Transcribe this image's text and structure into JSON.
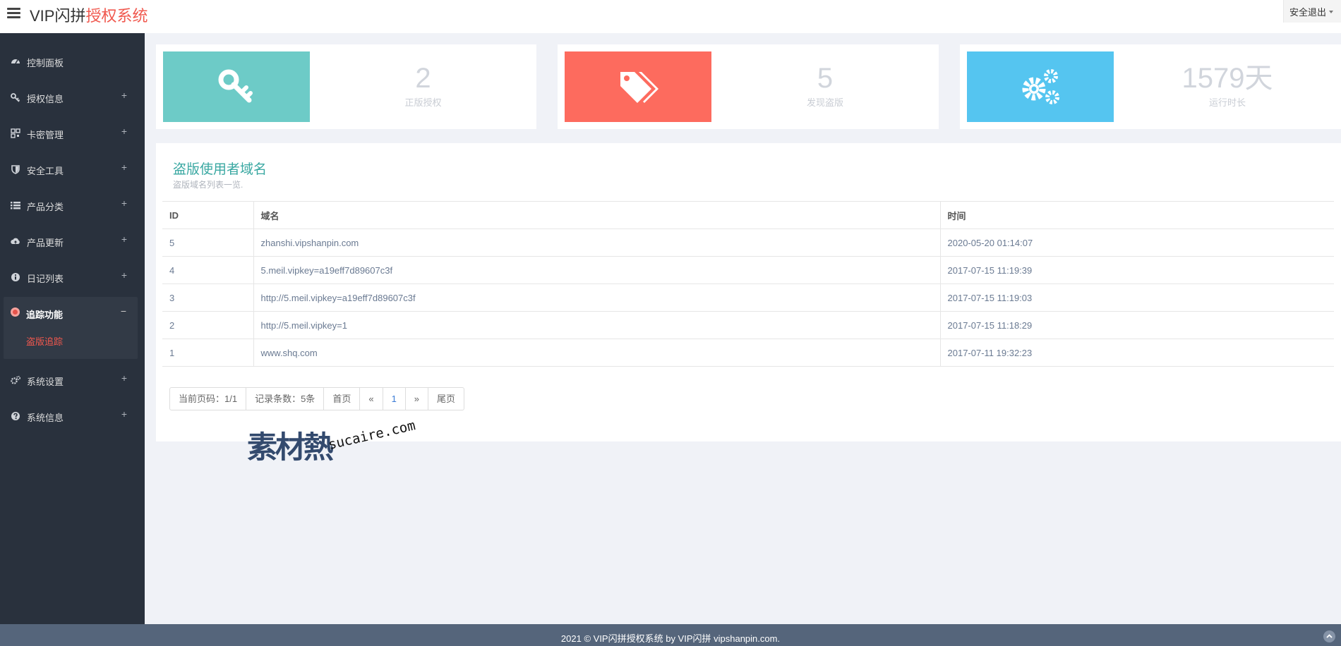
{
  "header": {
    "brand_prefix": "VIP闪拼",
    "brand_highlight": "授权系统",
    "logout_label": "安全退出"
  },
  "sidebar": {
    "items": [
      {
        "label": "控制面板",
        "toggle": "",
        "icon": "tachometer-icon"
      },
      {
        "label": "授权信息",
        "toggle": "+",
        "icon": "key-icon"
      },
      {
        "label": "卡密管理",
        "toggle": "+",
        "icon": "qrcode-icon"
      },
      {
        "label": "安全工具",
        "toggle": "+",
        "icon": "shield-icon"
      },
      {
        "label": "产品分类",
        "toggle": "+",
        "icon": "list-icon"
      },
      {
        "label": "产品更新",
        "toggle": "+",
        "icon": "cloud-upload-icon"
      },
      {
        "label": "日记列表",
        "toggle": "+",
        "icon": "info-circle-icon"
      },
      {
        "label": "系统设置",
        "toggle": "+",
        "icon": "cogs-icon"
      },
      {
        "label": "系统信息",
        "toggle": "+",
        "icon": "question-circle-icon"
      }
    ],
    "active": {
      "label": "追踪功能",
      "toggle": "−",
      "sub_label": "盗版追踪",
      "icon": "target-icon"
    }
  },
  "stats": [
    {
      "value": "2",
      "caption": "正版授权",
      "color": "#6dcbc7",
      "icon": "key-icon"
    },
    {
      "value": "5",
      "caption": "发现盗版",
      "color": "#fd6b5e",
      "icon": "tags-icon"
    },
    {
      "value": "1579天",
      "caption": "运行时长",
      "color": "#55c5f0",
      "icon": "cogs-icon"
    }
  ],
  "panel": {
    "title": "盗版使用者域名",
    "subtitle": "盗版域名列表一览.",
    "columns": [
      "ID",
      "域名",
      "时间"
    ],
    "rows": [
      [
        "5",
        "zhanshi.vipshanpin.com",
        "2020-05-20 01:14:07"
      ],
      [
        "4",
        "5.meil.vipkey=a19eff7d89607c3f",
        "2017-07-15 11:19:39"
      ],
      [
        "3",
        "http://5.meil.vipkey=a19eff7d89607c3f",
        "2017-07-15 11:19:03"
      ],
      [
        "2",
        "http://5.meil.vipkey=1",
        "2017-07-15 11:18:29"
      ],
      [
        "1",
        "www.shq.com",
        "2017-07-11 19:32:23"
      ]
    ]
  },
  "pager": {
    "current": "当前页码：1/1",
    "count": "记录条数：5条",
    "first": "首页",
    "prev": "«",
    "page": "1",
    "next": "»",
    "last": "尾页"
  },
  "watermark": {
    "logo": "素材熱",
    "text": "sucaire.com"
  },
  "footer": {
    "text": "2021 © VIP闪拼授权系统 by VIP闪拼 vipshanpin.com."
  }
}
